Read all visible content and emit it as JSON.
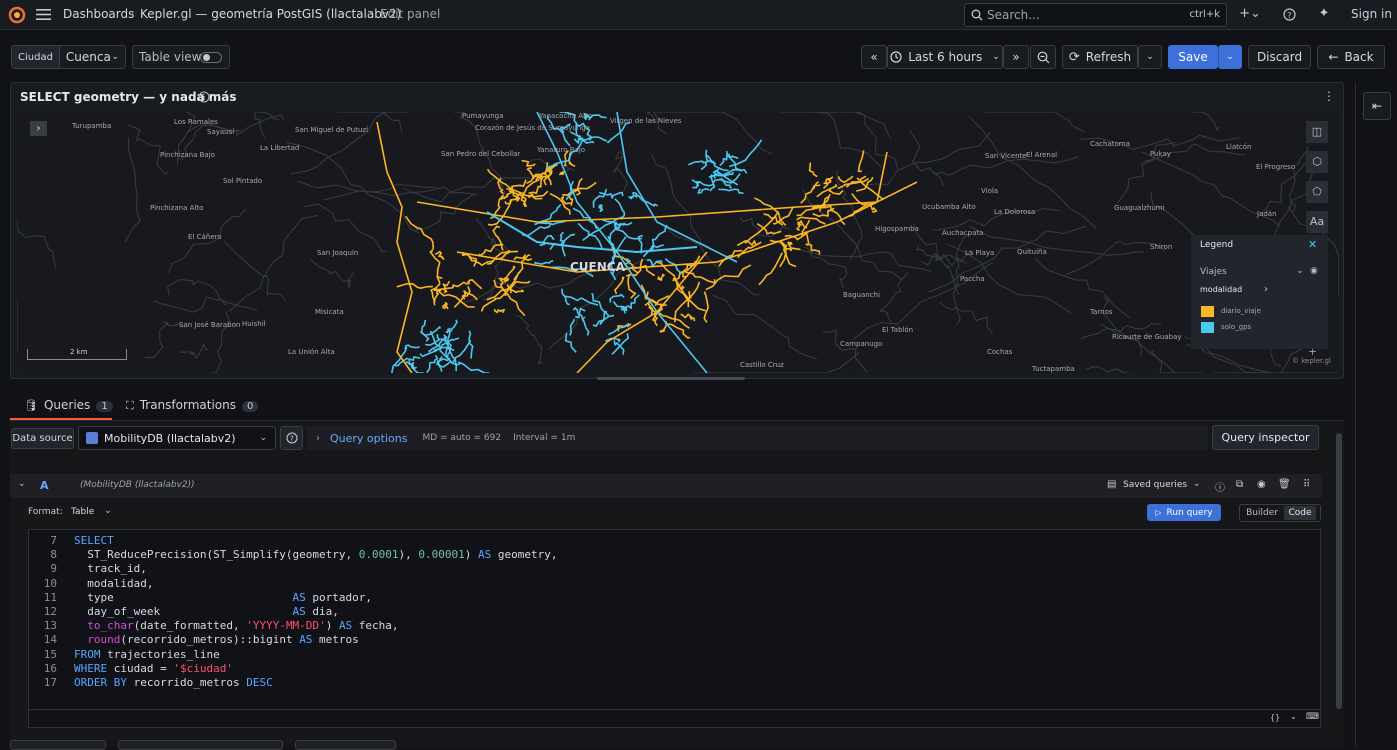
{
  "topbar": {
    "breadcrumbs": [
      "Dashboards",
      "Kepler.gl — geometría PostGIS (llactalabv2)",
      "Edit panel"
    ],
    "search_placeholder": "Search...",
    "search_shortcut": "ctrl+k",
    "sign_in": "Sign in"
  },
  "toolbar": {
    "variable_label": "Ciudad",
    "variable_value": "Cuenca",
    "table_view": "Table view",
    "time_range": "Last 6 hours",
    "refresh": "Refresh",
    "save": "Save",
    "discard": "Discard",
    "back": "Back"
  },
  "panel": {
    "title": "SELECT geometry — y nada más",
    "scale": "2 km",
    "attribution": "© kepler.gl",
    "places": [
      "Turupamba",
      "Los Ramales",
      "Sayausí",
      "San Miguel de Putuzí",
      "Pumayunga",
      "Corazón de Jesús de Sumayunga",
      "Yanacocha Alto",
      "Virgen de las Nieves",
      "Pinchizana Bajo",
      "La Libertad",
      "San Pedro del Cebollar",
      "Yanaturo Bajo",
      "San Vicente",
      "El Arenal",
      "Cachatoma",
      "Pukay",
      "Llatcón",
      "El Progreso",
      "Sol Pintado",
      "Viola",
      "Ucubamba Alto",
      "La Dolorosa",
      "Guagualzhumi",
      "Jadán",
      "Pinchizana Alto",
      "El Cáñero",
      "Higospamba",
      "Auchacpata",
      "San Joaquín",
      "CUENCA",
      "La Playa",
      "Quituiña",
      "Shiron",
      "Paccha",
      "Baguanchi",
      "Tarnos",
      "Ricaurte de Guabay",
      "San José Barabon",
      "Huishil",
      "Misicata",
      "El Tablón",
      "Campanugo",
      "La Unión Alta",
      "Cochas",
      "Castillo Cruz",
      "Tuctapamba"
    ],
    "legend": {
      "title": "Legend",
      "layer": "Viajes",
      "field": "modalidad",
      "items": [
        {
          "label": "diario_viaje",
          "color": "#fbb625"
        },
        {
          "label": "solo_gps",
          "color": "#4cc9f0"
        }
      ]
    },
    "map_colors": {
      "orange": "#fbb625",
      "blue": "#4cc9f0"
    }
  },
  "tabs": [
    {
      "label": "Queries",
      "count": "1"
    },
    {
      "label": "Transformations",
      "count": "0"
    }
  ],
  "query": {
    "datasource_label": "Data source",
    "datasource": "MobilityDB (llactalabv2)",
    "options_label": "Query options",
    "options_md": "MD = auto = 692",
    "options_interval": "Interval = 1m",
    "inspector": "Query inspector",
    "ref": "A",
    "ref_ds": "(MobilityDB (llactalabv2))",
    "saved_queries": "Saved queries",
    "format_label": "Format:",
    "format_value": "Table",
    "run_query": "Run query",
    "builder": "Builder",
    "code": "Code",
    "lines": [
      {
        "n": "7",
        "text": "SELECT"
      },
      {
        "n": "8",
        "text": "  ST_ReducePrecision(ST_Simplify(geometry, 0.0001), 0.00001) AS geometry,"
      },
      {
        "n": "9",
        "text": "  track_id,"
      },
      {
        "n": "10",
        "text": "  modalidad,"
      },
      {
        "n": "11",
        "text": "  type                           AS portador,"
      },
      {
        "n": "12",
        "text": "  day_of_week                    AS dia,"
      },
      {
        "n": "13",
        "text": "  to_char(date_formatted, 'YYYY-MM-DD') AS fecha,"
      },
      {
        "n": "14",
        "text": "  round(recorrido_metros)::bigint AS metros"
      },
      {
        "n": "15",
        "text": "FROM trajectories_line"
      },
      {
        "n": "16",
        "text": "WHERE ciudad = '$ciudad'"
      },
      {
        "n": "17",
        "text": "ORDER BY recorrido_metros DESC"
      }
    ]
  }
}
